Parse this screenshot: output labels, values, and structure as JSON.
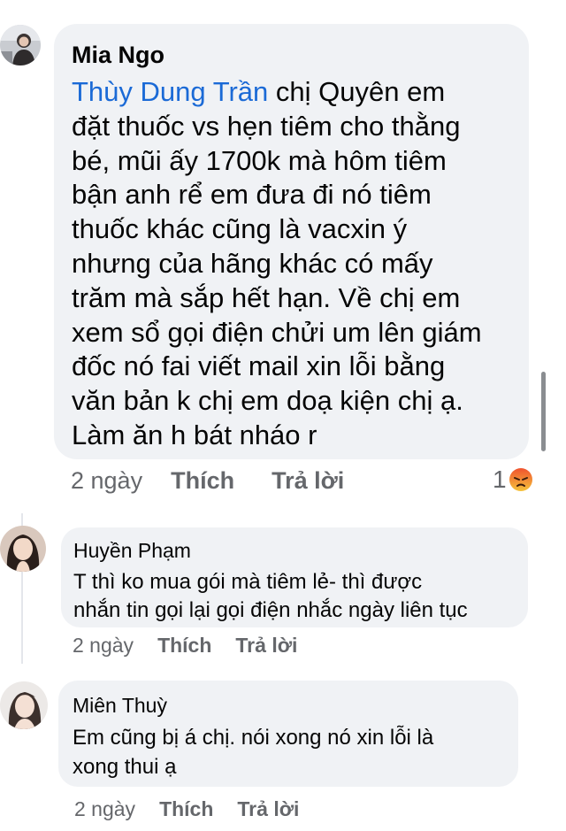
{
  "comments": [
    {
      "author": "Mia Ngo",
      "mention": "Thùy Dung Trần",
      "lines": [
        " chị Quyên em",
        "đặt thuốc vs hẹn tiêm cho thằng",
        "bé, mũi ấy 1700k mà hôm tiêm",
        "bận anh rể em đưa đi nó tiêm",
        "thuốc khác cũng là vacxin ý",
        "nhưng của hãng khác có mấy",
        "trăm mà sắp hết hạn. Về chị em",
        "xem sổ gọi điện chửi um lên giám",
        "đốc nó fai viết mail xin lỗi bằng",
        "văn bản k chị em doạ kiện chị ạ.",
        "Làm ăn h bát nháo r"
      ],
      "time": "2 ngày",
      "like_label": "Thích",
      "reply_label": "Trả lời",
      "reaction_count": "1",
      "reaction_icon": "angry-reaction-icon"
    },
    {
      "author": "Huyền Phạm",
      "lines": [
        "T thì ko mua gói mà tiêm lẻ- thì được",
        "nhắn tin gọi lại gọi điện nhắc ngày liên tục"
      ],
      "time": "2 ngày",
      "like_label": "Thích",
      "reply_label": "Trả lời"
    },
    {
      "author": "Miên Thuỳ",
      "lines": [
        "Em cũng bị á chị. nói xong nó xin lỗi là",
        "xong thui ạ"
      ],
      "time": "2 ngày",
      "like_label": "Thích",
      "reply_label": "Trả lời"
    }
  ],
  "colors": {
    "bubble": "#f0f2f5",
    "mention": "#1b6ad6",
    "meta": "#65676b",
    "angry": "#e9710f"
  }
}
